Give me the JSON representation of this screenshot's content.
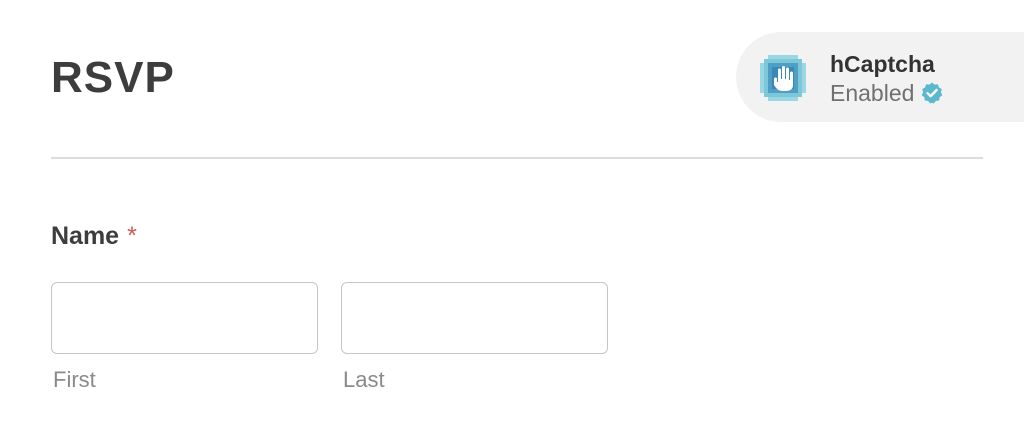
{
  "form": {
    "title": "RSVP"
  },
  "captcha": {
    "icon": "hcaptcha-hand-logo-icon",
    "name": "hCaptcha",
    "status": "Enabled",
    "status_icon": "verified-check-icon",
    "accent_color": "#5cb8cc",
    "badge_bg": "#f2f2f2"
  },
  "name_field": {
    "label": "Name",
    "required_mark": "*",
    "required_color": "#d05a4e",
    "first": {
      "value": "",
      "sublabel": "First"
    },
    "last": {
      "value": "",
      "sublabel": "Last"
    }
  }
}
